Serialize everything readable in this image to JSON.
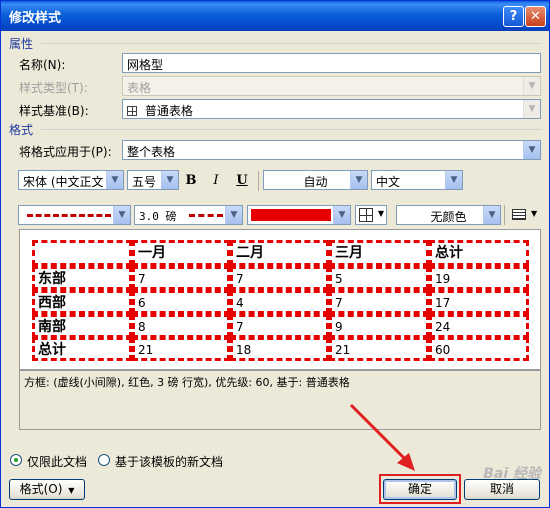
{
  "window": {
    "title": "修改样式",
    "help_glyph": "?",
    "close_glyph": "✕"
  },
  "properties": {
    "section_label": "属性",
    "name_label": "名称(N):",
    "name_value": "网格型",
    "type_label": "样式类型(T):",
    "type_value": "表格",
    "based_on_label": "样式基准(B):",
    "based_on_value": "普通表格"
  },
  "format": {
    "section_label": "格式",
    "apply_to_label": "将格式应用于(P):",
    "apply_to_value": "整个表格",
    "font_value": "宋体 (中文正文",
    "size_value": "五号",
    "bold": "B",
    "italic": "I",
    "underline": "U",
    "color_value": "自动",
    "language_value": "中文",
    "line_width_value": "3.0 磅",
    "shading_value": "无颜色",
    "border_color": "#e60000"
  },
  "preview_table": {
    "headers": [
      "",
      "一月",
      "二月",
      "三月",
      "总计"
    ],
    "rows": [
      [
        "东部",
        "7",
        "7",
        "5",
        "19"
      ],
      [
        "西部",
        "6",
        "4",
        "7",
        "17"
      ],
      [
        "南部",
        "8",
        "7",
        "9",
        "24"
      ],
      [
        "总计",
        "21",
        "18",
        "21",
        "60"
      ]
    ]
  },
  "description": "方框: (虚线(小间隙), 红色,  3 磅 行宽), 优先级: 60, 基于: 普通表格",
  "options": {
    "only_this_doc": "仅限此文档",
    "new_docs_template": "基于该模板的新文档"
  },
  "buttons": {
    "format": "格式(O)",
    "ok": "确定",
    "cancel": "取消"
  },
  "watermark": "Bai 经验"
}
